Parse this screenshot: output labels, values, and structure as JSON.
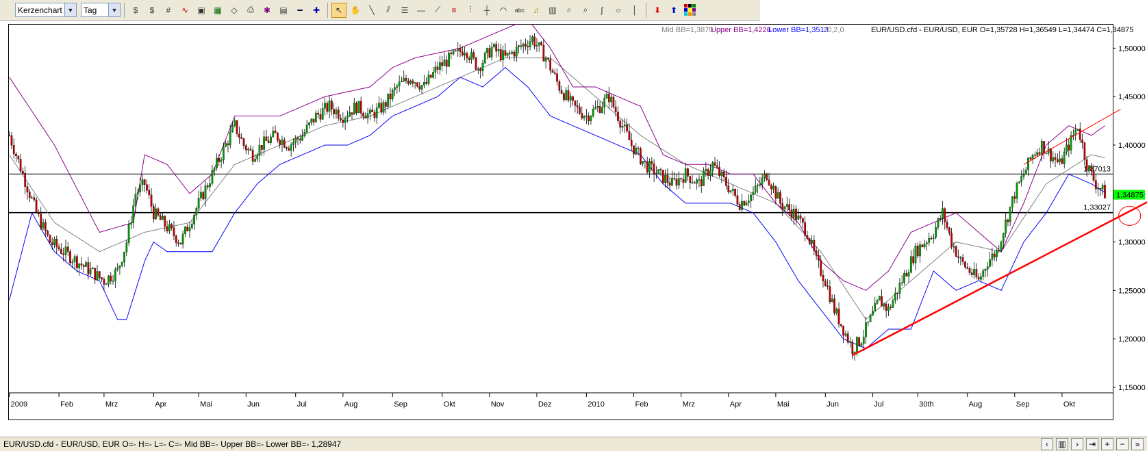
{
  "toolbar": {
    "chart_type": "Kerzenchart",
    "period": "Tag",
    "icons": [
      "currency-icon",
      "currency-icon",
      "grid-icon",
      "indicator-icon",
      "image-icon",
      "save-icon",
      "open-icon",
      "print-icon",
      "settings-icon",
      "window-icon",
      "zoom-out-icon",
      "zoom-in-icon",
      "cursor-icon",
      "hand-icon",
      "line-icon",
      "parallel-icon",
      "fib-icon",
      "hline-icon",
      "fan-icon",
      "fib-retracement-icon",
      "vertical-grid-icon",
      "crosshair-icon",
      "arc-icon",
      "text-icon",
      "alarm-icon",
      "calculator-icon",
      "zoom-icon",
      "zoom-area-icon",
      "freehand-icon",
      "circle-icon",
      "vline-icon",
      "sell-icon",
      "buy-icon",
      "colors-icon"
    ],
    "text_tool": "abc"
  },
  "legend": {
    "mid": "Mid BB=1,3870",
    "upper": "Upper BB=1,4226",
    "lower": "Lower BB=1,3513",
    "params": "20,2,0",
    "ohlc": "EUR/USD.cfd - EUR/USD, EUR O=1,35728 H=1,36549 L=1,34474 C=1,34875"
  },
  "colors": {
    "up": "#00a000",
    "down": "#c00000",
    "mid": "#808080",
    "upper": "#8b008b",
    "lower": "#0000ff",
    "trend": "#ff0000",
    "last_price_bg": "#00ff00"
  },
  "status": {
    "text": "EUR/USD.cfd - EUR/USD, EUR O=- H=- L=- C=-  Mid BB=- Upper BB=- Lower BB=-  1,28947"
  },
  "chart_data": {
    "type": "candlestick",
    "symbol": "EUR/USD.cfd",
    "ylim": [
      1.145,
      1.525
    ],
    "y_ticks": [
      "1,50000",
      "1,45000",
      "1,40000",
      "1,35000",
      "1,30000",
      "1,25000",
      "1,20000",
      "1,15000"
    ],
    "y_tick_values": [
      1.5,
      1.45,
      1.4,
      1.35,
      1.3,
      1.25,
      1.2,
      1.15
    ],
    "x_labels": [
      "2009",
      "Feb",
      "Mrz",
      "Apr",
      "Mai",
      "Jun",
      "Jul",
      "Aug",
      "Sep",
      "Okt",
      "Nov",
      "Dez",
      "2010",
      "Feb",
      "Mrz",
      "Apr",
      "Mai",
      "Jun",
      "Jul",
      "30th",
      "Aug",
      "Sep",
      "Okt"
    ],
    "x_label_index": [
      0,
      22,
      42,
      64,
      84,
      105,
      127,
      148,
      170,
      192,
      213,
      234,
      256,
      277,
      298,
      319,
      340,
      362,
      383,
      403,
      425,
      446,
      467
    ],
    "total_bars": 490,
    "horizontal_lines": [
      {
        "label": "1,37013",
        "value": 1.37013
      },
      {
        "label": "1,33027",
        "value": 1.33027
      }
    ],
    "last_price": {
      "label": "1,34875",
      "value": 1.34875
    },
    "trend_lines": [
      {
        "from": [
          374,
          1.183
        ],
        "to": [
          508,
          1.345
        ]
      },
      {
        "from": [
          450,
          1.38
        ],
        "to": [
          493,
          1.437
        ]
      }
    ],
    "circle": {
      "center": [
        497,
        1.327
      ]
    },
    "close_path": [
      [
        0,
        1.41
      ],
      [
        6,
        1.37
      ],
      [
        12,
        1.33
      ],
      [
        18,
        1.3
      ],
      [
        24,
        1.29
      ],
      [
        30,
        1.28
      ],
      [
        36,
        1.27
      ],
      [
        42,
        1.26
      ],
      [
        48,
        1.27
      ],
      [
        52,
        1.3
      ],
      [
        56,
        1.35
      ],
      [
        60,
        1.36
      ],
      [
        64,
        1.33
      ],
      [
        68,
        1.32
      ],
      [
        72,
        1.31
      ],
      [
        76,
        1.3
      ],
      [
        80,
        1.32
      ],
      [
        84,
        1.34
      ],
      [
        88,
        1.36
      ],
      [
        92,
        1.38
      ],
      [
        96,
        1.4
      ],
      [
        100,
        1.42
      ],
      [
        104,
        1.4
      ],
      [
        108,
        1.39
      ],
      [
        112,
        1.4
      ],
      [
        118,
        1.41
      ],
      [
        124,
        1.4
      ],
      [
        130,
        1.41
      ],
      [
        136,
        1.43
      ],
      [
        142,
        1.44
      ],
      [
        148,
        1.43
      ],
      [
        154,
        1.44
      ],
      [
        160,
        1.43
      ],
      [
        166,
        1.44
      ],
      [
        172,
        1.46
      ],
      [
        178,
        1.47
      ],
      [
        184,
        1.46
      ],
      [
        190,
        1.48
      ],
      [
        196,
        1.49
      ],
      [
        202,
        1.5
      ],
      [
        208,
        1.48
      ],
      [
        214,
        1.5
      ],
      [
        220,
        1.49
      ],
      [
        226,
        1.5
      ],
      [
        232,
        1.51
      ],
      [
        238,
        1.49
      ],
      [
        244,
        1.46
      ],
      [
        250,
        1.44
      ],
      [
        256,
        1.43
      ],
      [
        262,
        1.44
      ],
      [
        266,
        1.45
      ],
      [
        270,
        1.43
      ],
      [
        276,
        1.4
      ],
      [
        282,
        1.38
      ],
      [
        288,
        1.37
      ],
      [
        294,
        1.36
      ],
      [
        300,
        1.37
      ],
      [
        306,
        1.36
      ],
      [
        312,
        1.38
      ],
      [
        318,
        1.36
      ],
      [
        324,
        1.34
      ],
      [
        330,
        1.35
      ],
      [
        336,
        1.37
      ],
      [
        342,
        1.34
      ],
      [
        348,
        1.33
      ],
      [
        354,
        1.31
      ],
      [
        358,
        1.28
      ],
      [
        362,
        1.26
      ],
      [
        366,
        1.23
      ],
      [
        370,
        1.21
      ],
      [
        374,
        1.19
      ],
      [
        378,
        1.2
      ],
      [
        382,
        1.22
      ],
      [
        386,
        1.24
      ],
      [
        390,
        1.23
      ],
      [
        394,
        1.25
      ],
      [
        398,
        1.27
      ],
      [
        402,
        1.29
      ],
      [
        406,
        1.3
      ],
      [
        410,
        1.31
      ],
      [
        414,
        1.33
      ],
      [
        418,
        1.3
      ],
      [
        422,
        1.28
      ],
      [
        426,
        1.27
      ],
      [
        430,
        1.26
      ],
      [
        434,
        1.28
      ],
      [
        438,
        1.29
      ],
      [
        442,
        1.32
      ],
      [
        446,
        1.35
      ],
      [
        450,
        1.37
      ],
      [
        454,
        1.39
      ],
      [
        458,
        1.4
      ],
      [
        462,
        1.39
      ],
      [
        466,
        1.38
      ],
      [
        470,
        1.4
      ],
      [
        474,
        1.42
      ],
      [
        478,
        1.38
      ],
      [
        482,
        1.36
      ],
      [
        486,
        1.35
      ]
    ],
    "mid_bb": [
      [
        0,
        1.39
      ],
      [
        20,
        1.32
      ],
      [
        40,
        1.29
      ],
      [
        60,
        1.31
      ],
      [
        80,
        1.32
      ],
      [
        100,
        1.38
      ],
      [
        120,
        1.4
      ],
      [
        140,
        1.42
      ],
      [
        160,
        1.43
      ],
      [
        180,
        1.45
      ],
      [
        200,
        1.47
      ],
      [
        220,
        1.49
      ],
      [
        240,
        1.49
      ],
      [
        260,
        1.45
      ],
      [
        280,
        1.41
      ],
      [
        300,
        1.38
      ],
      [
        320,
        1.36
      ],
      [
        340,
        1.34
      ],
      [
        360,
        1.29
      ],
      [
        380,
        1.22
      ],
      [
        400,
        1.26
      ],
      [
        420,
        1.3
      ],
      [
        440,
        1.29
      ],
      [
        460,
        1.36
      ],
      [
        480,
        1.39
      ],
      [
        486,
        1.387
      ]
    ],
    "upper_bb": [
      [
        0,
        1.47
      ],
      [
        20,
        1.4
      ],
      [
        40,
        1.31
      ],
      [
        55,
        1.32
      ],
      [
        60,
        1.39
      ],
      [
        70,
        1.38
      ],
      [
        80,
        1.35
      ],
      [
        90,
        1.37
      ],
      [
        100,
        1.43
      ],
      [
        120,
        1.43
      ],
      [
        140,
        1.45
      ],
      [
        160,
        1.46
      ],
      [
        170,
        1.48
      ],
      [
        180,
        1.49
      ],
      [
        200,
        1.5
      ],
      [
        210,
        1.51
      ],
      [
        230,
        1.53
      ],
      [
        240,
        1.5
      ],
      [
        250,
        1.46
      ],
      [
        260,
        1.46
      ],
      [
        270,
        1.45
      ],
      [
        280,
        1.44
      ],
      [
        290,
        1.39
      ],
      [
        300,
        1.38
      ],
      [
        310,
        1.38
      ],
      [
        320,
        1.37
      ],
      [
        330,
        1.37
      ],
      [
        340,
        1.34
      ],
      [
        350,
        1.32
      ],
      [
        360,
        1.28
      ],
      [
        370,
        1.26
      ],
      [
        380,
        1.25
      ],
      [
        390,
        1.27
      ],
      [
        400,
        1.31
      ],
      [
        410,
        1.32
      ],
      [
        420,
        1.33
      ],
      [
        430,
        1.31
      ],
      [
        440,
        1.29
      ],
      [
        450,
        1.34
      ],
      [
        460,
        1.4
      ],
      [
        470,
        1.42
      ],
      [
        480,
        1.41
      ],
      [
        486,
        1.42
      ]
    ],
    "lower_bb": [
      [
        0,
        1.24
      ],
      [
        10,
        1.33
      ],
      [
        20,
        1.29
      ],
      [
        30,
        1.27
      ],
      [
        40,
        1.26
      ],
      [
        48,
        1.22
      ],
      [
        52,
        1.22
      ],
      [
        60,
        1.28
      ],
      [
        64,
        1.3
      ],
      [
        70,
        1.29
      ],
      [
        80,
        1.29
      ],
      [
        90,
        1.29
      ],
      [
        100,
        1.33
      ],
      [
        110,
        1.36
      ],
      [
        120,
        1.38
      ],
      [
        130,
        1.39
      ],
      [
        140,
        1.4
      ],
      [
        150,
        1.4
      ],
      [
        160,
        1.41
      ],
      [
        170,
        1.43
      ],
      [
        180,
        1.44
      ],
      [
        190,
        1.45
      ],
      [
        200,
        1.47
      ],
      [
        210,
        1.46
      ],
      [
        220,
        1.48
      ],
      [
        230,
        1.46
      ],
      [
        240,
        1.43
      ],
      [
        250,
        1.42
      ],
      [
        260,
        1.41
      ],
      [
        270,
        1.4
      ],
      [
        280,
        1.39
      ],
      [
        290,
        1.36
      ],
      [
        300,
        1.34
      ],
      [
        310,
        1.34
      ],
      [
        320,
        1.34
      ],
      [
        330,
        1.33
      ],
      [
        340,
        1.3
      ],
      [
        350,
        1.26
      ],
      [
        360,
        1.23
      ],
      [
        370,
        1.2
      ],
      [
        380,
        1.19
      ],
      [
        390,
        1.21
      ],
      [
        400,
        1.21
      ],
      [
        410,
        1.27
      ],
      [
        420,
        1.25
      ],
      [
        430,
        1.26
      ],
      [
        440,
        1.25
      ],
      [
        450,
        1.3
      ],
      [
        460,
        1.33
      ],
      [
        470,
        1.37
      ],
      [
        480,
        1.36
      ],
      [
        486,
        1.351
      ]
    ]
  }
}
